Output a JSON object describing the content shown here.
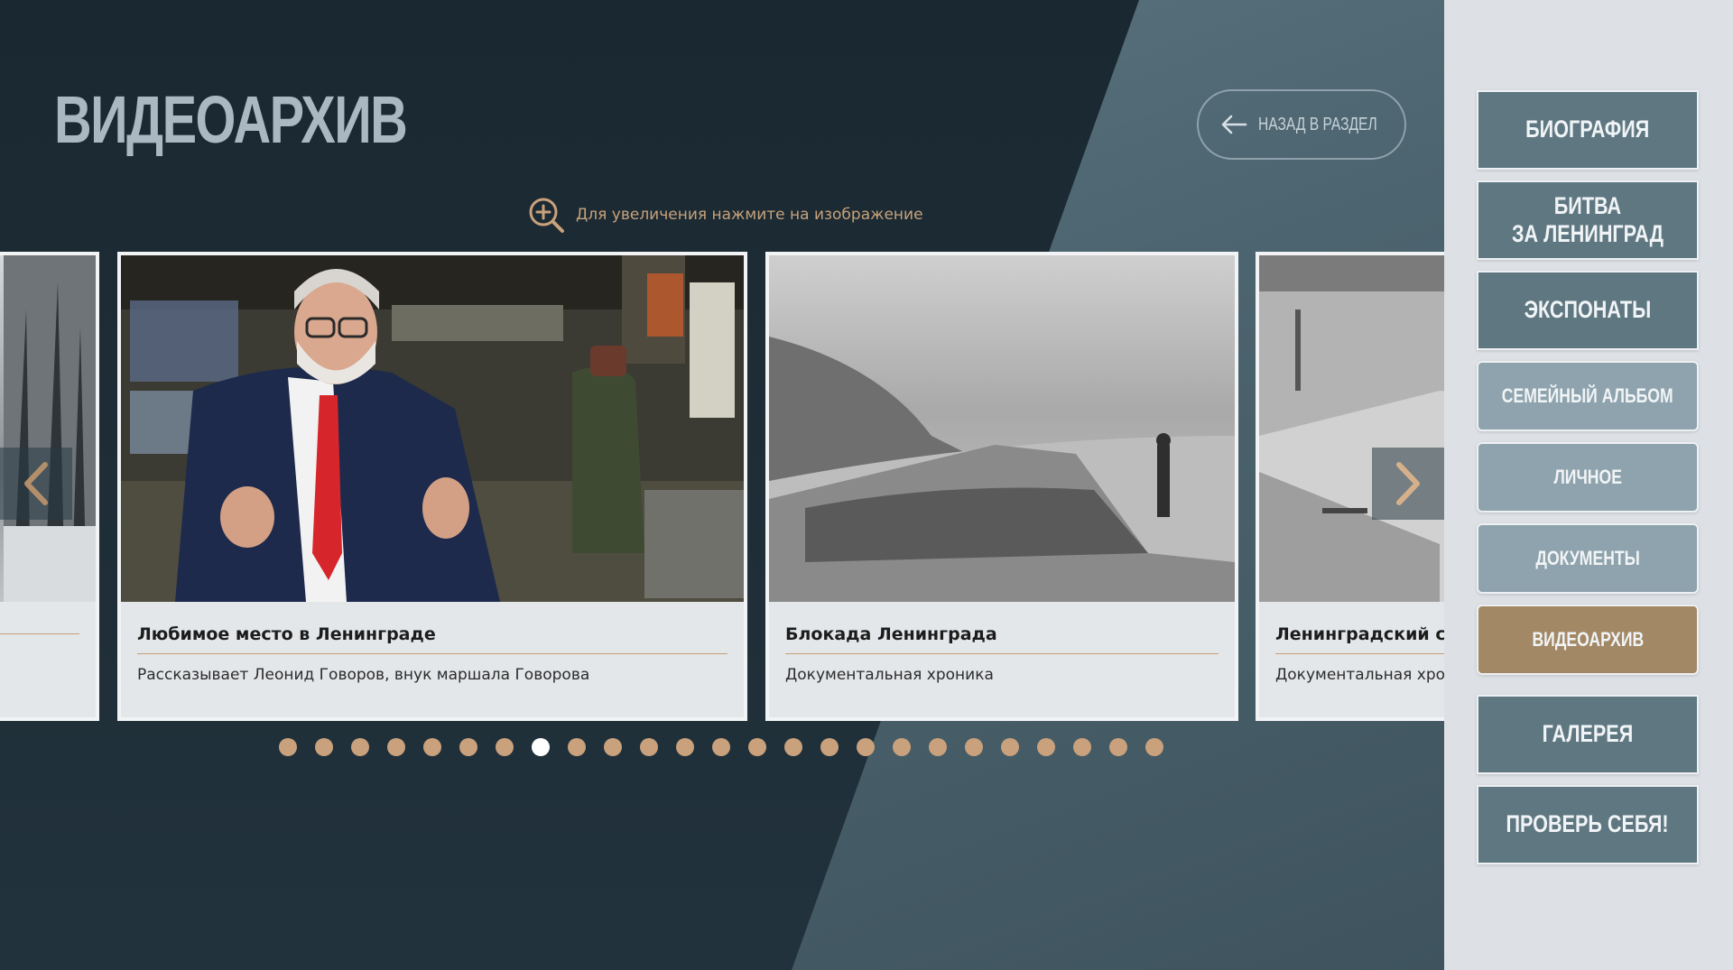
{
  "header": {
    "title": "ВИДЕОАРХИВ",
    "back_label": "НАЗАД В РАЗДЕЛ",
    "zoom_hint": "Для увеличения нажмите на изображение"
  },
  "cards": [
    {
      "title": "",
      "subtitle": ""
    },
    {
      "title": "Любимое место в Ленинграде",
      "subtitle": "Рассказывает Леонид Говоров, внук маршала Говорова"
    },
    {
      "title": "Блокада Ленинграда",
      "subtitle": "Документальная хроника"
    },
    {
      "title": "Ленинградский са",
      "subtitle": "Документальная хро"
    }
  ],
  "pager": {
    "total": 25,
    "active_index": 7
  },
  "sidebar": {
    "items": [
      {
        "label": "БИОГРАФИЯ"
      },
      {
        "label": "БИТВА\nЗА ЛЕНИНГРАД"
      },
      {
        "label": "ЭКСПОНАТЫ"
      },
      {
        "label": "СЕМЕЙНЫЙ АЛЬБОМ"
      },
      {
        "label": "ЛИЧНОЕ"
      },
      {
        "label": "ДОКУМЕНТЫ"
      },
      {
        "label": "ВИДЕОАРХИВ"
      },
      {
        "label": "ГАЛЕРЕЯ"
      },
      {
        "label": "ПРОВЕРЬ СЕБЯ!"
      }
    ]
  },
  "colors": {
    "accent": "#c9a17c",
    "active_nav": "#a38866",
    "primary_nav": "#5e7781",
    "secondary_nav": "#8ea3ad"
  },
  "icons": {
    "back": "arrow-left-icon",
    "zoom": "zoom-in-icon",
    "prev": "chevron-left-icon",
    "next": "chevron-right-icon"
  }
}
